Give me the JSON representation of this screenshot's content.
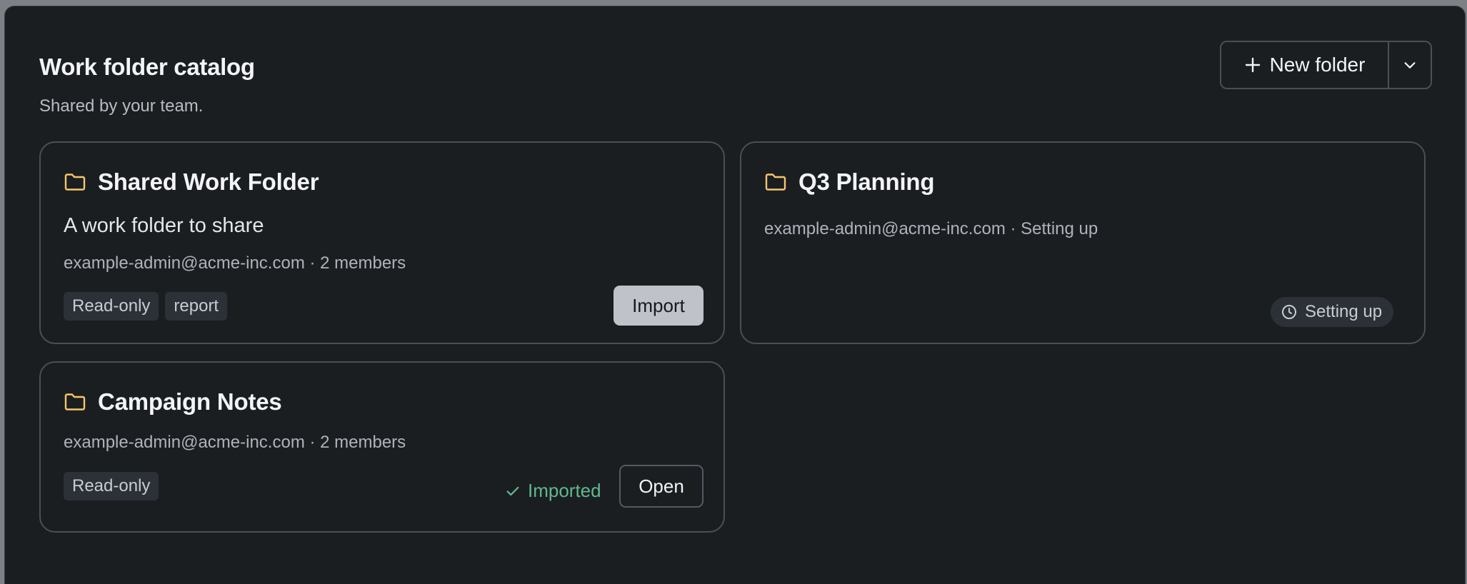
{
  "header": {
    "title": "Work folder catalog",
    "subtitle": "Shared by your team.",
    "new_folder_label": "New folder"
  },
  "folders": [
    {
      "name": "Shared Work Folder",
      "description": "A work folder to share",
      "meta": "example-admin@acme-inc.com · 2 members",
      "tags": [
        "Read-only",
        "report"
      ],
      "action_label": "Import"
    },
    {
      "name": "Q3 Planning",
      "meta": "example-admin@acme-inc.com · Setting up",
      "status_label": "Setting up"
    },
    {
      "name": "Campaign Notes",
      "meta": "example-admin@acme-inc.com · 2 members",
      "tags": [
        "Read-only"
      ],
      "imported_label": "Imported",
      "action_label": "Open"
    }
  ],
  "colors": {
    "folder_icon": "#f5c66b",
    "imported": "#5fb98e",
    "background": "#1b1e21"
  },
  "icons": [
    "plus-icon",
    "chevron-down-icon",
    "folder-icon",
    "clock-icon",
    "check-icon"
  ]
}
